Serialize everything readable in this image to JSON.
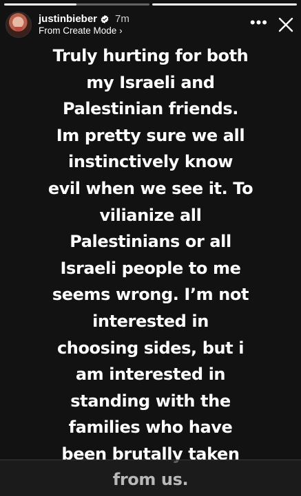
{
  "story": {
    "progress": [
      0.5,
      1.0
    ],
    "username": "justinbieber",
    "time": "7m",
    "subtitle": "From Create Mode",
    "chevron": "›",
    "more_label": "•••",
    "lines": [
      "Truly hurting for both",
      "my Israeli and",
      "Palestinian friends.",
      "Im pretty sure we all",
      "instinctively know",
      "evil when we see it. To",
      "vilianize all",
      "Palestinians or all",
      "Israeli people to me",
      "seems wrong. I’m not",
      "interested in",
      "choosing sides, but i",
      "am interested in",
      "standing with the",
      "families who have",
      "been brutally taken"
    ],
    "last_line": "from us."
  },
  "icons": {
    "verified": "verified-badge-icon",
    "more": "more-dots-icon",
    "close": "close-icon",
    "chevron": "chevron-right-icon"
  },
  "colors": {
    "background": "#121212",
    "text": "#ffffff",
    "verified": "#3897f0"
  }
}
